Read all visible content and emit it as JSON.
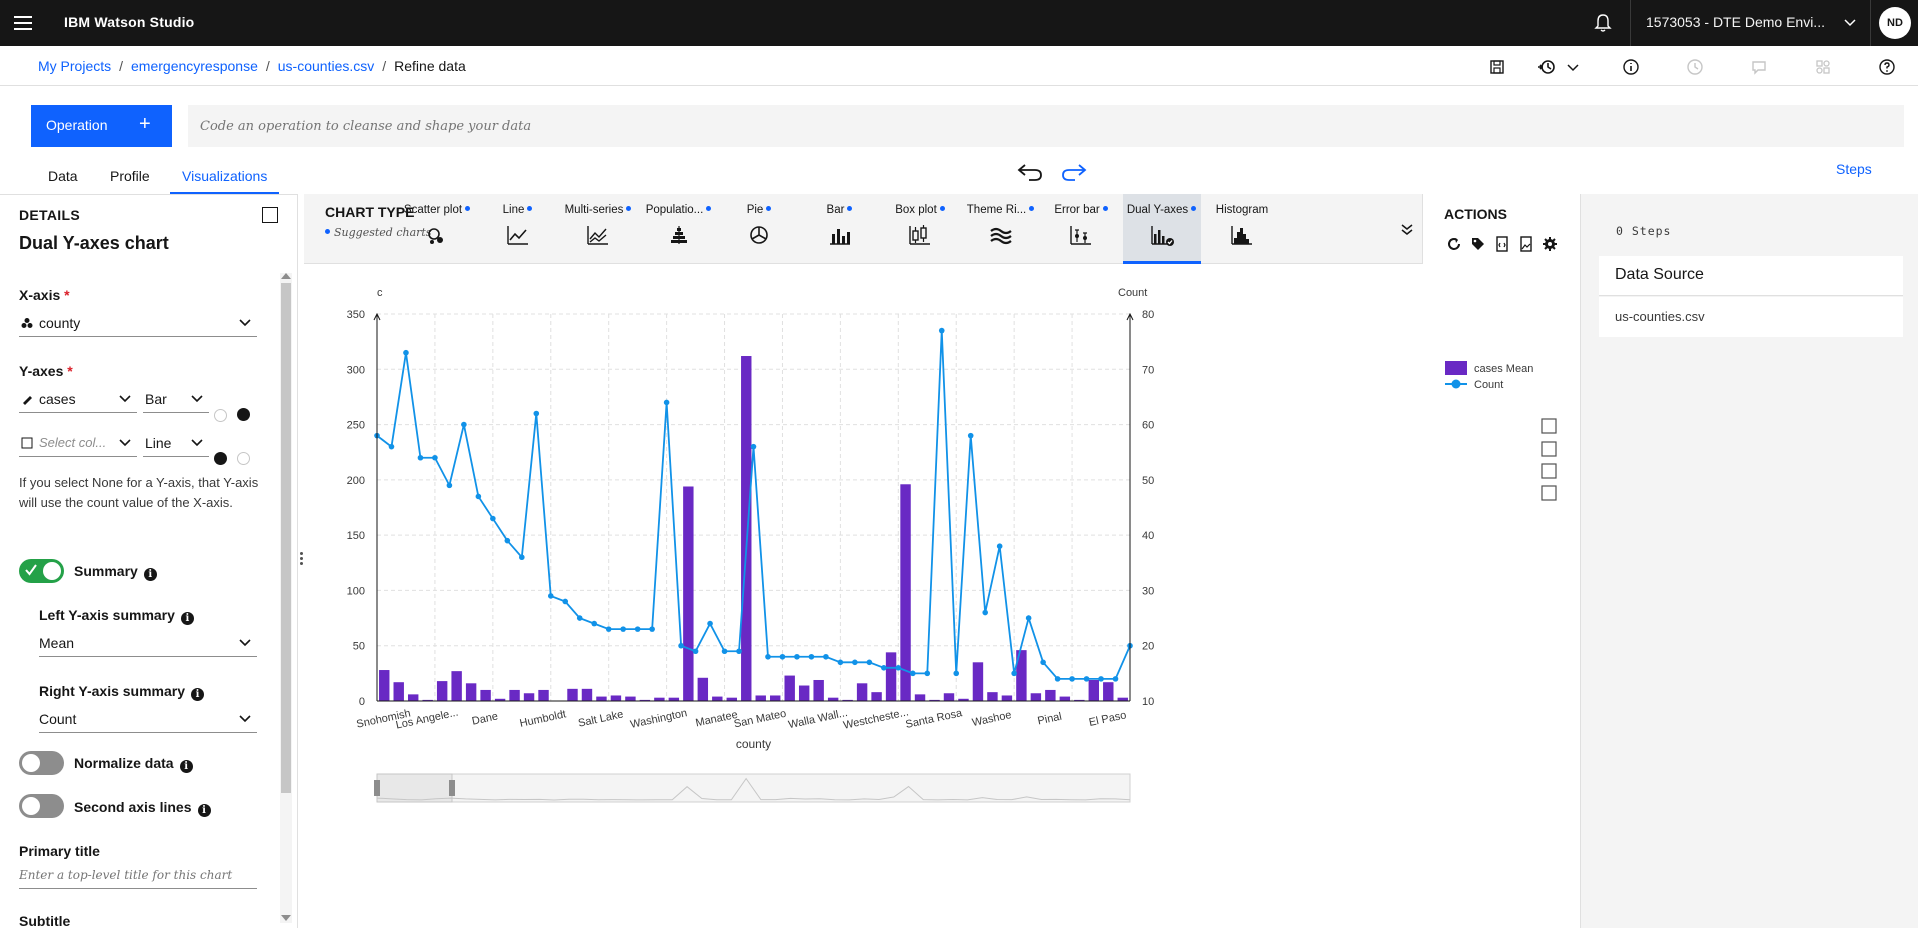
{
  "app": {
    "brand": "IBM Watson Studio",
    "account": "1573053 - DTE Demo Envi...",
    "avatar": "ND"
  },
  "breadcrumb": {
    "items": [
      "My Projects",
      "emergencyresponse",
      "us-counties.csv"
    ],
    "current": "Refine data"
  },
  "operation": {
    "label": "Operation",
    "plus": "+",
    "placeholder": "Code an operation to cleanse and shape your data"
  },
  "tabs": [
    {
      "label": "Data"
    },
    {
      "label": "Profile"
    },
    {
      "label": "Visualizations",
      "active": true
    }
  ],
  "steps_link": "Steps",
  "details": {
    "header": "DETAILS",
    "chart_name": "Dual Y-axes chart",
    "x_axis_label": "X-axis",
    "x_axis_value": "county",
    "y_axes_label": "Y-axes",
    "y1_column": "cases",
    "y1_type": "Bar",
    "y2_column_placeholder": "Select col...",
    "y2_type": "Line",
    "help_text": "If you select None for a Y-axis, that Y-axis will use the count value of the X-axis.",
    "summary_label": "Summary",
    "summary_on": true,
    "left_summary_label": "Left Y-axis summary",
    "left_summary_value": "Mean",
    "right_summary_label": "Right Y-axis summary",
    "right_summary_value": "Count",
    "normalize_label": "Normalize data",
    "normalize_on": false,
    "second_axis_label": "Second axis lines",
    "second_axis_on": false,
    "primary_title_label": "Primary title",
    "primary_title_placeholder": "Enter a top-level title for this chart",
    "subtitle_label": "Subtitle",
    "required_mark": "*"
  },
  "chart_type": {
    "title": "CHART TYPE",
    "suggested": "Suggested charts",
    "items": [
      {
        "name": "Scatter plot",
        "suggested": true,
        "icon": "scatter-icon"
      },
      {
        "name": "Line",
        "suggested": true,
        "icon": "line-chart-icon"
      },
      {
        "name": "Multi-series",
        "suggested": true,
        "icon": "multi-series-icon"
      },
      {
        "name": "Populatio...",
        "suggested": true,
        "icon": "population-pyramid-icon"
      },
      {
        "name": "Pie",
        "suggested": true,
        "icon": "pie-chart-icon"
      },
      {
        "name": "Bar",
        "suggested": true,
        "icon": "bar-chart-icon"
      },
      {
        "name": "Box plot",
        "suggested": true,
        "icon": "box-plot-icon"
      },
      {
        "name": "Theme Ri...",
        "suggested": true,
        "icon": "theme-river-icon"
      },
      {
        "name": "Error bar",
        "suggested": true,
        "icon": "error-bar-icon"
      },
      {
        "name": "Dual Y-axes",
        "suggested": true,
        "icon": "dual-y-axes-icon",
        "active": true
      },
      {
        "name": "Histogram",
        "suggested": false,
        "icon": "histogram-icon"
      }
    ]
  },
  "actions": {
    "title": "ACTIONS"
  },
  "right_panel": {
    "steps_count": "0 Steps",
    "data_source_title": "Data Source",
    "data_source_file": "us-counties.csv"
  },
  "colors": {
    "accent": "#0f62fe",
    "bar": "#6929c4",
    "line": "#1192e8",
    "toggle_on": "#24a148"
  },
  "chart_data": {
    "type": "bar",
    "xlabel": "county",
    "ylabel": "c",
    "y2label": "Count",
    "ylim": [
      0,
      350
    ],
    "y2lim": [
      10,
      80
    ],
    "yticks": [
      0,
      50,
      100,
      150,
      200,
      250,
      300,
      350
    ],
    "y2ticks": [
      10,
      20,
      30,
      40,
      50,
      60,
      70,
      80
    ],
    "xtick_labels": [
      "Snohomish",
      "Los Angele...",
      "Dane",
      "Humboldt",
      "Salt Lake",
      "Washington",
      "Manatee",
      "San Mateo",
      "Walla Wall...",
      "Westcheste...",
      "Santa Rosa",
      "Washoe",
      "Pinal",
      "El Paso"
    ],
    "xtick_positions": [
      0,
      3,
      7,
      11,
      15,
      19,
      23,
      26,
      30,
      34,
      38,
      42,
      46,
      50
    ],
    "legend": {
      "position": "right",
      "items": [
        "cases Mean",
        "Count"
      ]
    },
    "grid": true,
    "series": [
      {
        "name": "cases Mean",
        "kind": "bar",
        "axis": "left",
        "values": [
          28,
          17,
          6,
          1,
          18,
          27,
          16,
          10,
          2,
          10,
          7,
          10,
          0,
          11,
          11,
          4,
          5,
          4,
          1,
          3,
          3,
          194,
          21,
          4,
          3,
          312,
          5,
          5,
          23,
          14,
          19,
          3,
          1,
          16,
          8,
          44,
          196,
          6,
          1,
          7,
          2,
          35,
          8,
          5,
          46,
          7,
          10,
          4,
          1,
          19,
          17,
          3
        ]
      },
      {
        "name": "Count",
        "kind": "line",
        "axis": "right",
        "values": [
          58,
          56,
          73,
          54,
          54,
          49,
          60,
          47,
          43,
          39,
          36,
          62,
          29,
          28,
          25,
          24,
          23,
          23,
          23,
          23,
          64,
          20,
          19,
          24,
          19,
          19,
          56,
          18,
          18,
          18,
          18,
          18,
          17,
          17,
          17,
          16,
          16,
          15,
          15,
          77,
          15,
          58,
          26,
          38,
          15,
          25,
          17,
          14,
          14,
          14,
          14,
          14,
          20
        ]
      }
    ]
  }
}
